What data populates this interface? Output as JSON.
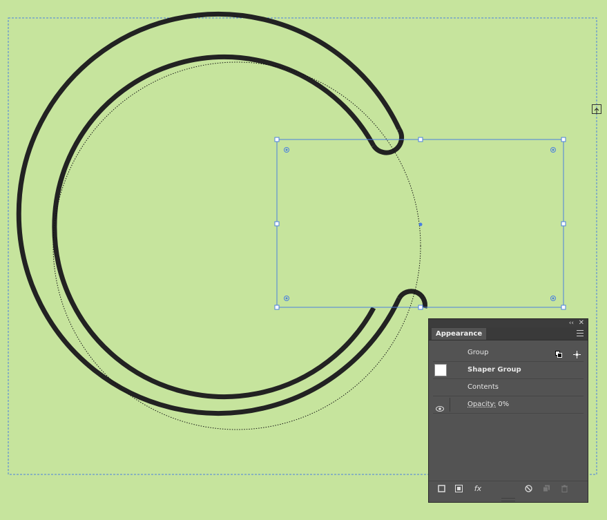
{
  "panel": {
    "tab_label": "Appearance",
    "collapse_glyph": "‹‹",
    "close_glyph": "✕",
    "rows": {
      "group": "Group",
      "shaper_group": "Shaper Group",
      "contents": "Contents",
      "opacity_label": "Opacity:",
      "opacity_value": "0%"
    },
    "bottom_buttons": {
      "new_stroke": "new-stroke-icon",
      "new_fill": "new-fill-icon",
      "fx_label": "fx",
      "clear": "clear-appearance-icon",
      "duplicate": "duplicate-item-icon",
      "delete": "trash-icon"
    }
  },
  "colors": {
    "canvas_bg": "#c6e49d",
    "stroke": "#222222",
    "selection": "#4a7fe0",
    "panel_bg": "#535353"
  }
}
